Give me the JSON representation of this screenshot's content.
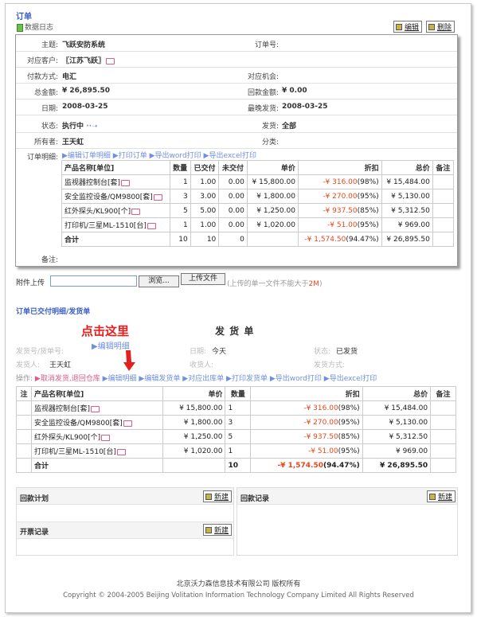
{
  "header": {
    "title": "订单",
    "data_log": "数据日志",
    "edit": "编辑",
    "delete": "删除"
  },
  "order": {
    "fields": {
      "subject_label": "主题:",
      "subject": "飞跃安防系统",
      "order_no_label": "订单号:",
      "order_no": "",
      "customer_label": "对应客户:",
      "customer": "〖江苏飞跃〗",
      "payment_label": "付款方式:",
      "payment": "电汇",
      "opportunity_label": "对应机会:",
      "opportunity": "",
      "total_label": "总金额:",
      "total": "¥ 26,895.50",
      "received_label": "回款金额:",
      "received": "¥ 0.00",
      "date_label": "日期:",
      "date": "2008-03-25",
      "latest_ship_label": "最晚发货:",
      "latest_ship": "2008-03-25",
      "status_label": "状态:",
      "status": "执行中",
      "ship_label": "发货:",
      "ship": "全部",
      "owner_label": "所有者:",
      "owner": "王天虹",
      "category_label": "分类:",
      "category": "",
      "detail_label": "订单明细:",
      "remark_label": "备注:"
    },
    "detail_actions": [
      "编辑订单明细",
      "打印订单",
      "导出word打印",
      "导出excel打印"
    ],
    "columns": [
      "产品名称[单位]",
      "数量",
      "已交付",
      "未交付",
      "单价",
      "折扣",
      "总价",
      "备注"
    ],
    "rows": [
      {
        "name": "监视器控制台[套]",
        "qty": "1",
        "delivered": "1.00",
        "undelivered": "0.00",
        "price": "¥ 15,800.00",
        "disc": "-¥ 316.00",
        "pct": "(98%)",
        "total": "¥ 15,484.00"
      },
      {
        "name": "安全监控设备/QM9800[套]",
        "qty": "3",
        "delivered": "3.00",
        "undelivered": "0.00",
        "price": "¥ 1,800.00",
        "disc": "-¥ 270.00",
        "pct": "(95%)",
        "total": "¥ 5,130.00"
      },
      {
        "name": "红外探头/KL900[个]",
        "qty": "5",
        "delivered": "5.00",
        "undelivered": "0.00",
        "price": "¥ 1,250.00",
        "disc": "-¥ 937.50",
        "pct": "(85%)",
        "total": "¥ 5,312.50"
      },
      {
        "name": "打印机/三星ML-1510[台]",
        "qty": "1",
        "delivered": "1.00",
        "undelivered": "0.00",
        "price": "¥ 1,020.00",
        "disc": "-¥ 51.00",
        "pct": "(95%)",
        "total": "¥ 969.00"
      }
    ],
    "sum": {
      "label": "合计",
      "qty": "10",
      "delivered": "10",
      "undelivered": "0",
      "disc": "-¥ 1,574.50",
      "pct": "(94.47%)",
      "total": "¥ 26,895.50"
    }
  },
  "attachment": {
    "label": "附件上传",
    "browse": "浏览...",
    "upload": "上传文件",
    "hint_pre": "(上传的单一文件不能大于",
    "hint_size": "2M",
    "hint_post": ")"
  },
  "shipping": {
    "section_title": "订单已交付明细/发货单",
    "doc_title": "发 货 单",
    "callout": "点击这里",
    "callout_link": "▶编辑明细",
    "no_label": "发货号/货单号:",
    "date_label": "日期:",
    "date": "今天",
    "status_label": "状态:",
    "status": "已发货",
    "shipper_label": "发货人:",
    "shipper": "王天虹",
    "receiver_label": "收货人:",
    "method_label": "发货方式:",
    "ops_label": "操作:",
    "ops_red": "取消发货,退回仓库",
    "ops_links": [
      "编辑明细",
      "编辑发货单",
      "对应出库单",
      "打印发货单",
      "导出word打印",
      "导出excel打印"
    ],
    "columns": [
      "注",
      "产品名称[单位]",
      "单价",
      "数量",
      "折扣",
      "总价",
      "备注"
    ],
    "rows": [
      {
        "name": "监视器控制台[套]",
        "price": "¥ 15,800.00",
        "qty": "1",
        "disc": "-¥ 316.00",
        "pct": "(98%)",
        "total": "¥ 15,484.00"
      },
      {
        "name": "安全监控设备/QM9800[套]",
        "price": "¥ 1,800.00",
        "qty": "3",
        "disc": "-¥ 270.00",
        "pct": "(95%)",
        "total": "¥ 5,130.00"
      },
      {
        "name": "红外探头/KL900[个]",
        "price": "¥ 1,250.00",
        "qty": "5",
        "disc": "-¥ 937.50",
        "pct": "(85%)",
        "total": "¥ 5,312.50"
      },
      {
        "name": "打印机/三星ML-1510[台]",
        "price": "¥ 1,020.00",
        "qty": "1",
        "disc": "-¥ 51.00",
        "pct": "(95%)",
        "total": "¥ 969.00"
      }
    ],
    "sum": {
      "label": "合计",
      "qty": "10",
      "disc": "-¥ 1,574.50",
      "pct": "(94.47%)",
      "total": "¥ 26,895.50"
    }
  },
  "panels": {
    "payment_plan": "回款计划",
    "payment_record": "回款记录",
    "invoice_record": "开票记录",
    "new": "新建"
  },
  "footer": {
    "company": "北京沃力森信息技术有限公司  版权所有",
    "copyright": "Copyright © 2004-2005 Beijing Volitation Information Technology Company Limited All Rights Reserved"
  }
}
